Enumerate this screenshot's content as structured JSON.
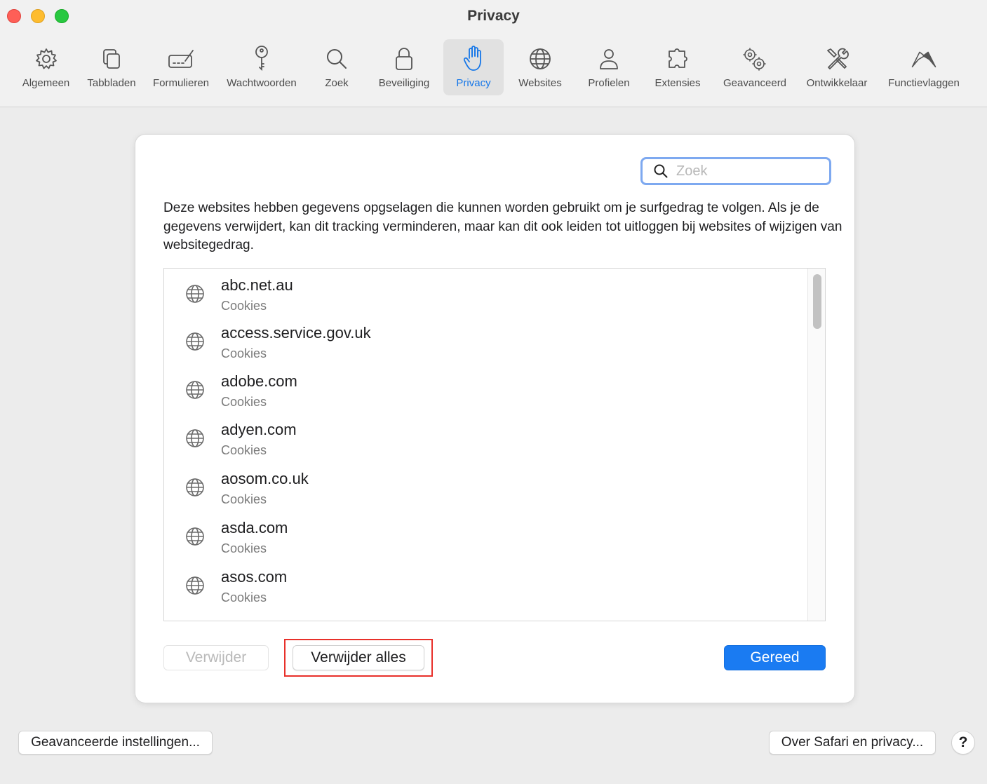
{
  "window": {
    "title": "Privacy"
  },
  "toolbar": {
    "tabs": [
      {
        "label": "Algemeen",
        "icon": "gear-icon"
      },
      {
        "label": "Tabbladen",
        "icon": "tabs-icon"
      },
      {
        "label": "Formulieren",
        "icon": "form-autofill-icon"
      },
      {
        "label": "Wachtwoorden",
        "icon": "key-icon"
      },
      {
        "label": "Zoek",
        "icon": "search-icon"
      },
      {
        "label": "Beveiliging",
        "icon": "lock-icon"
      },
      {
        "label": "Privacy",
        "icon": "hand-icon",
        "active": true
      },
      {
        "label": "Websites",
        "icon": "globe-icon"
      },
      {
        "label": "Profielen",
        "icon": "person-icon"
      },
      {
        "label": "Extensies",
        "icon": "puzzle-icon"
      },
      {
        "label": "Geavanceerd",
        "icon": "gears-icon"
      },
      {
        "label": "Ontwikkelaar",
        "icon": "tools-icon"
      },
      {
        "label": "Functievlaggen",
        "icon": "flags-icon"
      }
    ]
  },
  "sheet": {
    "search_placeholder": "Zoek",
    "description": "Deze websites hebben gegevens opgselagen die kunnen worden gebruikt om je surfgedrag te volgen. Als je de gegevens verwijdert, kan dit tracking verminderen, maar kan dit ook leiden tot uitloggen bij websites of wijzigen van websitegedrag.",
    "websites": [
      {
        "site": "abc.net.au",
        "kind": "Cookies"
      },
      {
        "site": "access.service.gov.uk",
        "kind": "Cookies"
      },
      {
        "site": "adobe.com",
        "kind": "Cookies"
      },
      {
        "site": "adyen.com",
        "kind": "Cookies"
      },
      {
        "site": "aosom.co.uk",
        "kind": "Cookies"
      },
      {
        "site": "asda.com",
        "kind": "Cookies"
      },
      {
        "site": "asos.com",
        "kind": "Cookies"
      }
    ],
    "remove_label": "Verwijder",
    "remove_all_label": "Verwijder alles",
    "done_label": "Gereed"
  },
  "footer": {
    "advanced_label": "Geavanceerde instellingen...",
    "about_label": "Over Safari en privacy...",
    "help_label": "?"
  },
  "colors": {
    "accent": "#1a7bf2",
    "highlight": "#e8302a"
  }
}
